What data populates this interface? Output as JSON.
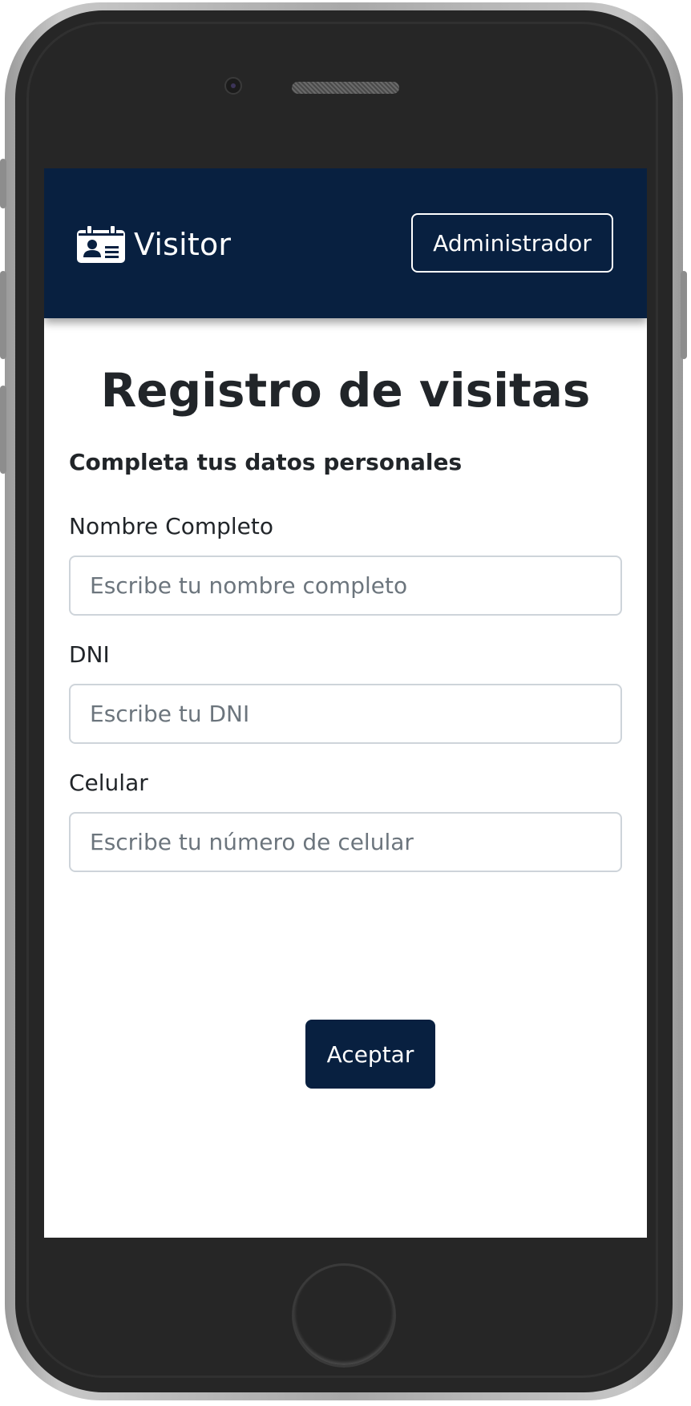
{
  "brand": {
    "name": "Visitor",
    "icon": "id-card-icon"
  },
  "header": {
    "admin_button_label": "Administrador"
  },
  "main": {
    "title": "Registro de visitas",
    "subtitle": "Completa tus datos personales",
    "fields": [
      {
        "label": "Nombre Completo",
        "value": "",
        "placeholder": "Escribe tu nombre completo"
      },
      {
        "label": "DNI",
        "value": "",
        "placeholder": "Escribe tu DNI"
      },
      {
        "label": "Celular",
        "value": "",
        "placeholder": "Escribe tu número de celular"
      }
    ],
    "submit_label": "Aceptar"
  },
  "colors": {
    "navbar": "#082040",
    "button": "#082040",
    "text": "#212529",
    "placeholder": "#6c757d",
    "input_border": "#ced4da"
  }
}
